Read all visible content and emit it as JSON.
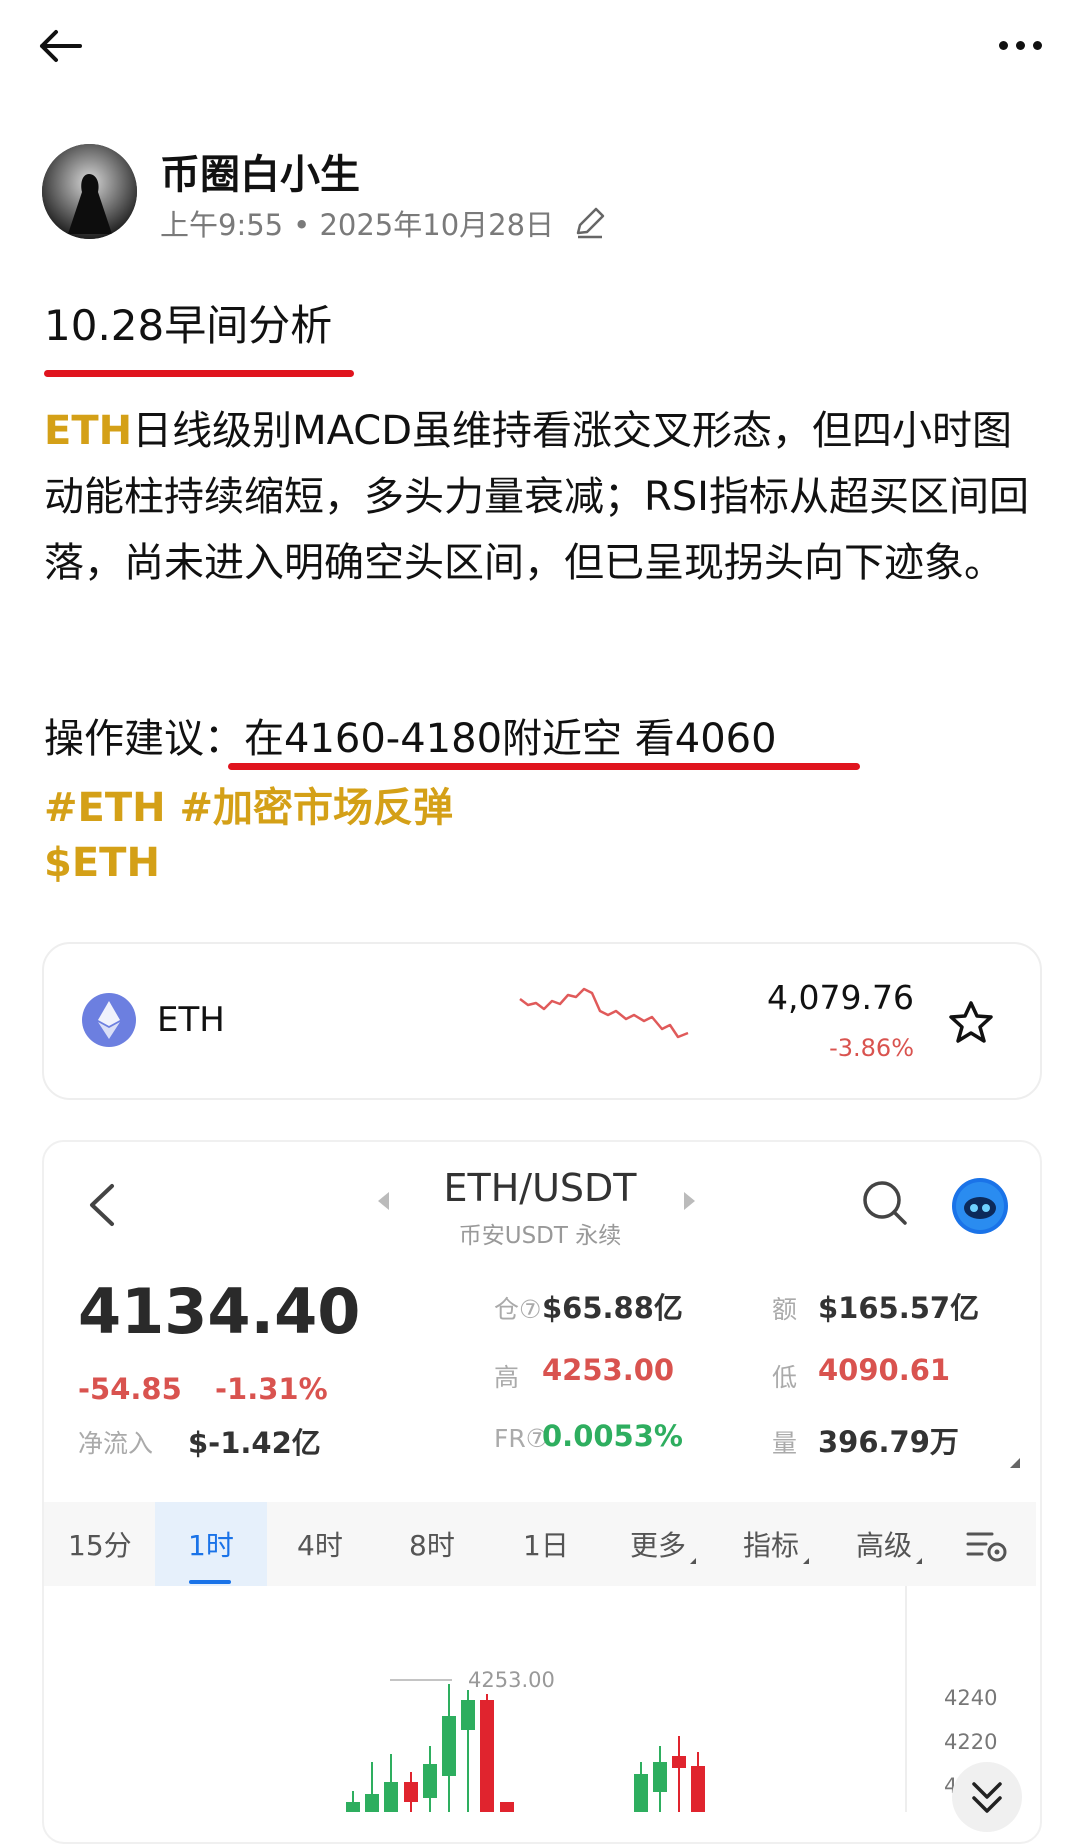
{
  "post": {
    "author": "币圈白小生",
    "time": "上午9:55",
    "date": "• 2025年10月28日",
    "title": "10.28早间分析",
    "body_tag": "ETH",
    "body_text": "日线级别MACD虽维持看涨交叉形态，但四小时图动能柱持续缩短，多头力量衰减；RSI指标从超买区间回落，尚未进入明确空头区间，但已呈现拐头向下迹象。",
    "suggestion": "操作建议：在4160-4180附近空 看4060",
    "hashtags": "#ETH #加密市场反弹",
    "cashtag": "$ETH"
  },
  "ticker": {
    "symbol": "ETH",
    "price": "4,079.76",
    "change": "-3.86%",
    "colors": {
      "down": "#d9534f",
      "brand": "#6c7fe0"
    }
  },
  "market": {
    "pair": "ETH/USDT",
    "pair_sub": "币安USDT 永续",
    "last_price": "4134.40",
    "change_abs": "-54.85",
    "change_pct": "-1.31%",
    "netflow_label": "净流入",
    "netflow_value": "$-1.42亿",
    "oi_label": "仓⑦",
    "oi_value": "$65.88亿",
    "turnover_label": "额",
    "turnover_value": "$165.57亿",
    "high_label": "高",
    "high_value": "4253.00",
    "low_label": "低",
    "low_value": "4090.61",
    "fr_label": "FR⑦",
    "fr_value": "0.0053%",
    "qty_label": "量",
    "qty_value": "396.79万",
    "tabs": [
      "15分",
      "1时",
      "4时",
      "8时",
      "1日",
      "更多",
      "指标",
      "高级"
    ],
    "active_tab": "1时",
    "chart_high_label": "4253.00",
    "axis_ticks": [
      "4240",
      "4220",
      "4"
    ],
    "colors": {
      "up": "#2eae5f",
      "down": "#e0242e",
      "accent": "#1a73e8"
    }
  }
}
